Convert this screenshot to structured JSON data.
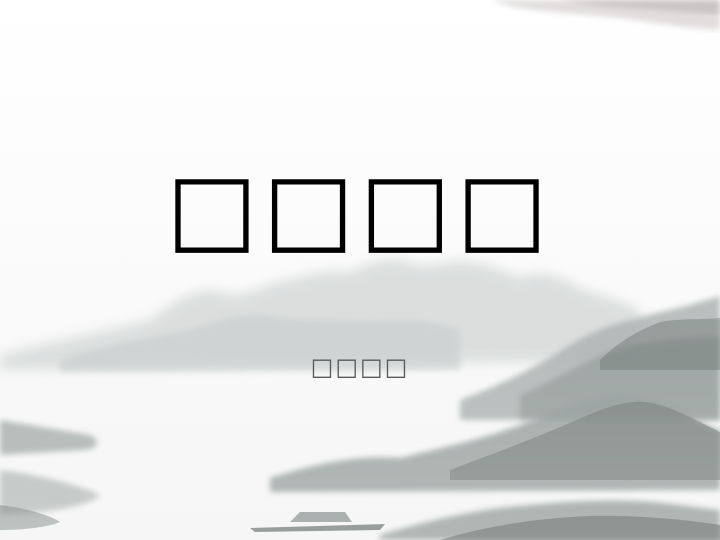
{
  "slide": {
    "title": "□□□□",
    "subtitle": "□□□□"
  },
  "colors": {
    "background": "#ffffff",
    "title": "#000000",
    "subtitle": "#5a5a5a",
    "ink_light": "#d6d9da",
    "ink_mid": "#a6adac",
    "ink_dark": "#6b7370"
  }
}
